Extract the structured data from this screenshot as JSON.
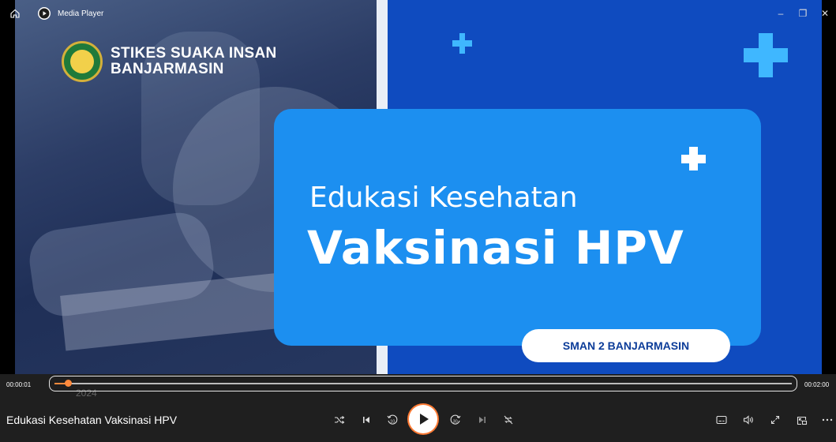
{
  "window": {
    "app_title": "Media Player",
    "controls": {
      "minimize": "–",
      "restore": "❐",
      "close": "✕"
    }
  },
  "video_frame": {
    "brand_line1": "STIKES SUAKA INSAN",
    "brand_line2": "BANJARMASIN",
    "card_subtitle": "Edukasi Kesehatan",
    "card_title": "Vaksinasi HPV",
    "pill_label": "SMAN 2 BANJARMASIN",
    "ghost_text": "2024"
  },
  "playback": {
    "current_time": "00:00:01",
    "total_time": "00:02:00",
    "progress_fraction": 0.008,
    "media_title": "Edukasi Kesehatan Vaksinasi HPV"
  },
  "icons": {
    "home": "home-icon",
    "app": "media-player-icon",
    "shuffle": "shuffle-icon",
    "previous": "skip-previous-icon",
    "rewind10": "rewind-10-icon",
    "play": "play-icon",
    "forward30": "forward-30-icon",
    "next": "skip-next-icon",
    "repeat": "repeat-off-icon",
    "subtitles": "subtitles-icon",
    "volume": "volume-icon",
    "fullscreen": "fullscreen-icon",
    "miniplayer": "mini-player-icon",
    "more": "more-icon"
  },
  "colors": {
    "accent": "#ff7a33",
    "card_blue": "#1c8ff0",
    "panel_blue": "#0f4bbf",
    "plus_cyan": "#3fb7ff"
  }
}
